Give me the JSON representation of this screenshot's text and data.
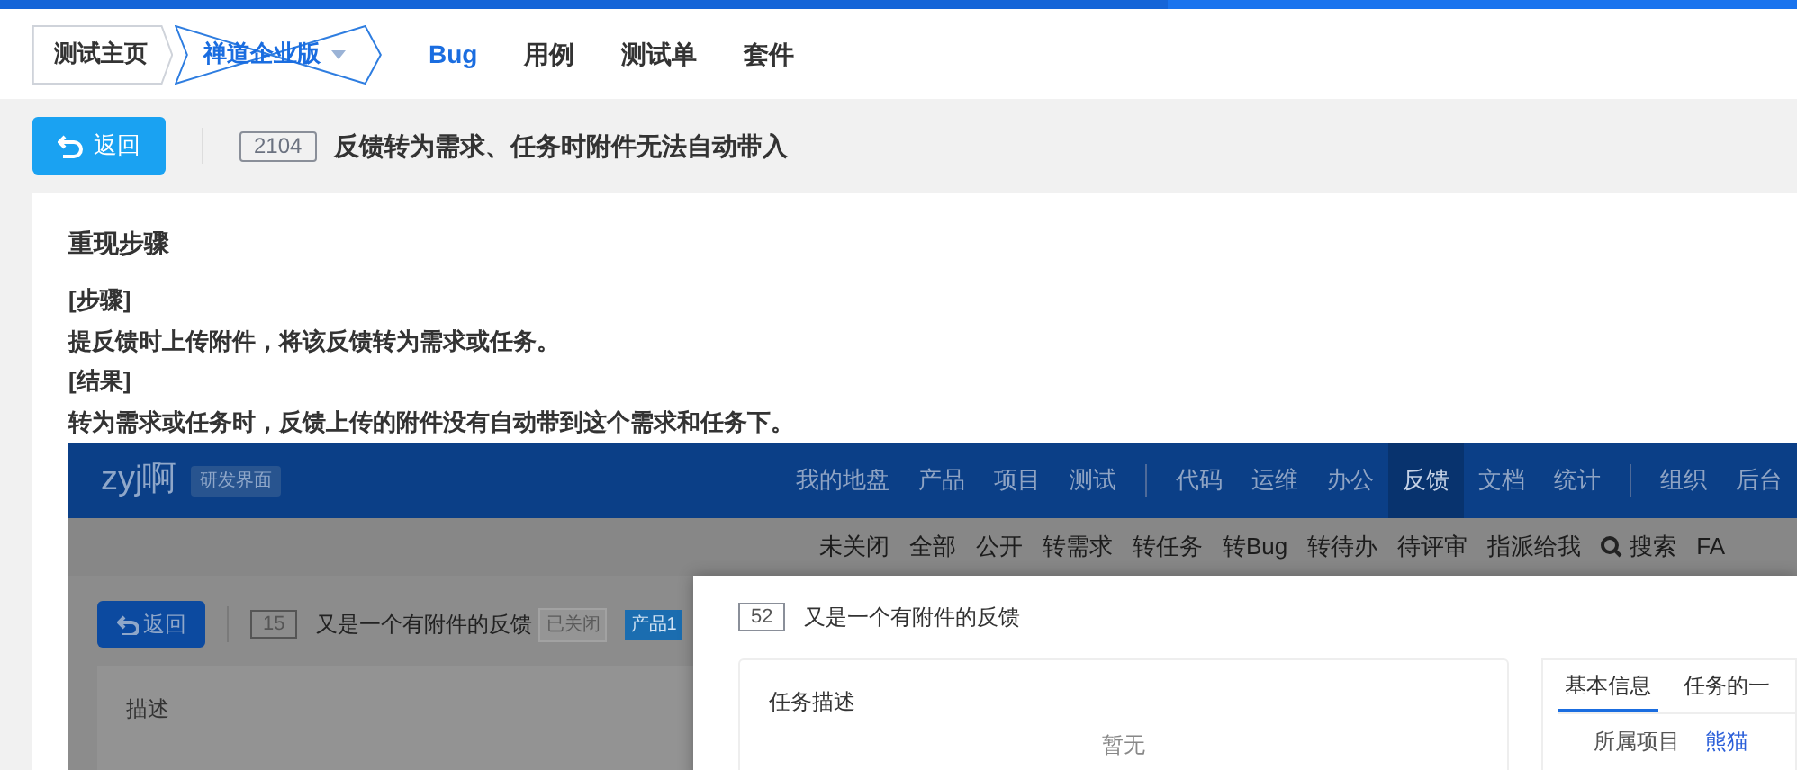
{
  "header": {
    "breadcrumbs": [
      {
        "label": "测试主页",
        "kind": "home"
      },
      {
        "label": "禅道企业版",
        "kind": "dropdown"
      }
    ],
    "tabs": [
      {
        "label": "Bug",
        "selected": true
      },
      {
        "label": "用例",
        "selected": false
      },
      {
        "label": "测试单",
        "selected": false
      },
      {
        "label": "套件",
        "selected": false
      }
    ]
  },
  "toolbar": {
    "back_button": "返回",
    "id": "2104",
    "title": "反馈转为需求、任务时附件无法自动带入"
  },
  "section": {
    "heading": "重现步骤",
    "lines": [
      "[步骤]",
      "提反馈时上传附件，将该反馈转为需求或任务。",
      "[结果]",
      "转为需求或任务时，反馈上传的附件没有自动带到这个需求和任务下。"
    ]
  },
  "screenshot": {
    "brand": "zyj啊",
    "brand_tag": "研发界面",
    "nav_groups": [
      [
        {
          "label": "我的地盘",
          "selected": false
        },
        {
          "label": "产品",
          "selected": false
        },
        {
          "label": "项目",
          "selected": false
        },
        {
          "label": "测试",
          "selected": false
        }
      ],
      [
        {
          "label": "代码",
          "selected": false
        },
        {
          "label": "运维",
          "selected": false
        },
        {
          "label": "办公",
          "selected": false
        },
        {
          "label": "反馈",
          "selected": true
        },
        {
          "label": "文档",
          "selected": false
        },
        {
          "label": "统计",
          "selected": false
        }
      ],
      [
        {
          "label": "组织",
          "selected": false
        },
        {
          "label": "后台",
          "selected": false
        }
      ]
    ],
    "subnav": [
      {
        "label": "未关闭",
        "kind": "link"
      },
      {
        "label": "全部",
        "kind": "link"
      },
      {
        "label": "公开",
        "kind": "link"
      },
      {
        "label": "转需求",
        "kind": "link"
      },
      {
        "label": "转任务",
        "kind": "link"
      },
      {
        "label": "转Bug",
        "kind": "link"
      },
      {
        "label": "转待办",
        "kind": "link"
      },
      {
        "label": "待评审",
        "kind": "link"
      },
      {
        "label": "指派给我",
        "kind": "link"
      },
      {
        "label": "搜索",
        "kind": "search"
      },
      {
        "label": "FA",
        "kind": "link"
      }
    ],
    "back_button": "返回",
    "id": "15",
    "title": "又是一个有附件的反馈",
    "status": "已关闭",
    "product": "产品1",
    "description_heading": "描述",
    "modal": {
      "id": "52",
      "title": "又是一个有附件的反馈",
      "panel_heading": "任务描述",
      "empty_text": "暂无",
      "tabs": [
        {
          "label": "基本信息",
          "selected": true
        },
        {
          "label": "任务的一",
          "selected": false
        }
      ],
      "fields": [
        {
          "label": "所属项目",
          "value": "熊猫"
        }
      ]
    }
  }
}
